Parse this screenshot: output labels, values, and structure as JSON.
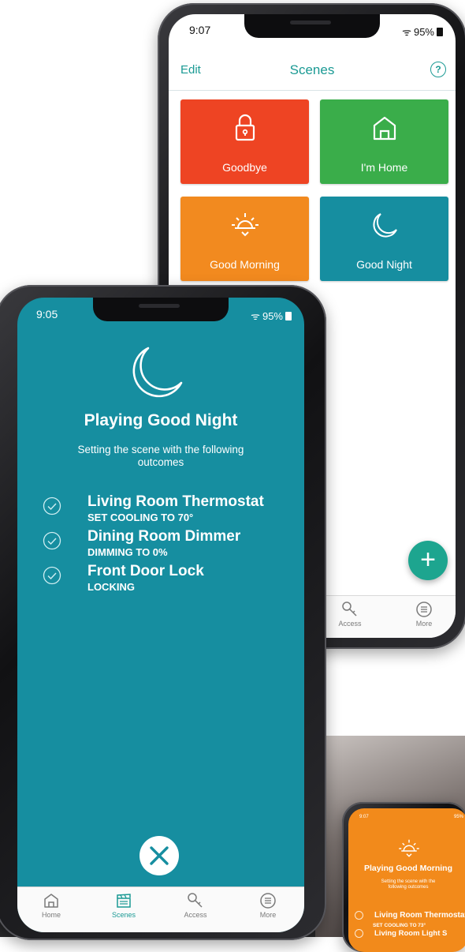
{
  "back_phone": {
    "status": {
      "time": "9:07",
      "battery": "95%"
    },
    "header": {
      "edit": "Edit",
      "title": "Scenes",
      "help": "?"
    },
    "tiles": [
      {
        "label": "Goodbye",
        "icon": "lock-icon",
        "color": "#ee4423"
      },
      {
        "label": "I'm Home",
        "icon": "house-icon",
        "color": "#3aad4a"
      },
      {
        "label": "Good Morning",
        "icon": "sunrise-icon",
        "color": "#f28a1f"
      },
      {
        "label": "Good Night",
        "icon": "moon-icon",
        "color": "#168ea0"
      }
    ],
    "fab": "+",
    "nav": [
      {
        "label": "Access",
        "icon": "key-icon"
      },
      {
        "label": "More",
        "icon": "menu-icon"
      }
    ]
  },
  "front_phone": {
    "status": {
      "time": "9:05",
      "battery": "95%"
    },
    "title": "Playing Good Night",
    "subtitle": "Setting the scene with the following outcomes",
    "outcomes": [
      {
        "name": "Living Room Thermostat",
        "action": "SET COOLING TO 70°"
      },
      {
        "name": "Dining Room Dimmer",
        "action": "DIMMING TO 0%"
      },
      {
        "name": "Front Door Lock",
        "action": "LOCKING"
      }
    ],
    "nav": [
      {
        "label": "Home",
        "icon": "house-icon"
      },
      {
        "label": "Scenes",
        "icon": "clapperboard-icon",
        "active": true
      },
      {
        "label": "Access",
        "icon": "key-icon"
      },
      {
        "label": "More",
        "icon": "menu-icon"
      }
    ],
    "accent": "#168ea0"
  },
  "mini_phone": {
    "time": "9:07",
    "status": "95%",
    "title": "Playing Good Morning",
    "subtitle": "Setting the scene with the following outcomes",
    "items": [
      "Living Room Thermostat",
      "SET COOLING TO 73°",
      "Living Room Light S"
    ],
    "color": "#f28a1b"
  }
}
